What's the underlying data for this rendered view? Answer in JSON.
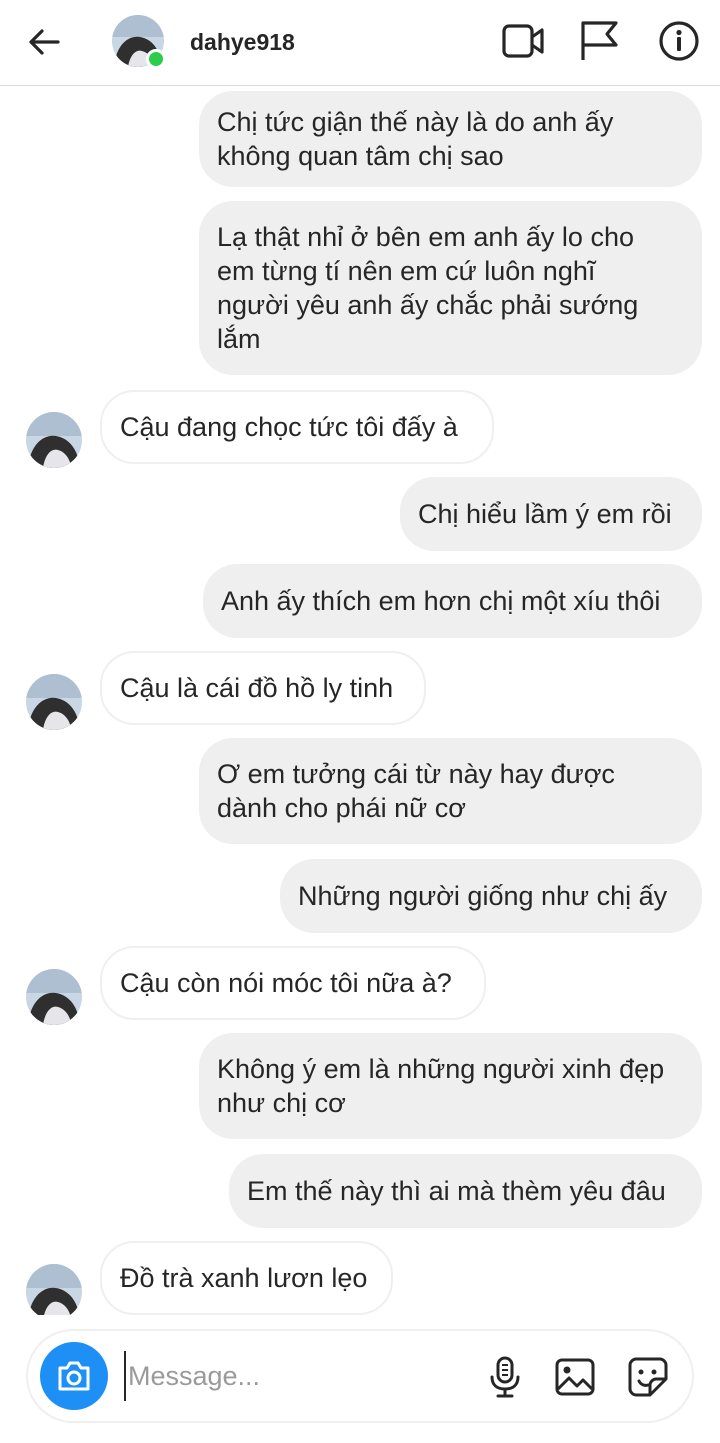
{
  "header": {
    "username": "dahye918",
    "online": true
  },
  "icons": {
    "back": "arrow-left-icon",
    "video": "video-call-icon",
    "flag": "flag-icon",
    "info": "info-icon",
    "camera": "camera-icon",
    "mic": "microphone-icon",
    "gallery": "gallery-icon",
    "sticker": "sticker-icon"
  },
  "colors": {
    "online": "#2ecc4b",
    "camera_button": "#1e90f5",
    "outgoing_bubble": "#efefef"
  },
  "messages": [
    {
      "direction": "out",
      "text": "Chị tức giận thế này là do anh ấy\nkhông quan tâm chị sao"
    },
    {
      "direction": "out",
      "text": "Lạ thật nhỉ ở bên em anh ấy lo cho\nem từng tí nên em cứ luôn nghĩ\nngười yêu anh ấy chắc phải sướng\nlắm"
    },
    {
      "direction": "in",
      "text": "Cậu đang chọc tức tôi đấy à"
    },
    {
      "direction": "out",
      "text": "Chị hiểu lầm ý em rồi"
    },
    {
      "direction": "out",
      "text": "Anh ấy thích em hơn chị một xíu thôi"
    },
    {
      "direction": "in",
      "text": "Cậu là cái đồ hồ ly tinh"
    },
    {
      "direction": "out",
      "text": "Ơ em tưởng cái từ này hay được\ndành cho phái nữ cơ"
    },
    {
      "direction": "out",
      "text": "Những người giống như chị ấy"
    },
    {
      "direction": "in",
      "text": "Cậu còn nói móc tôi nữa à?"
    },
    {
      "direction": "out",
      "text": "Không ý em là những người xinh đẹp\nnhư chị cơ"
    },
    {
      "direction": "out",
      "text": "Em thế này thì ai mà thèm yêu đâu"
    },
    {
      "direction": "in",
      "text": "Đồ trà xanh lươn lẹo"
    }
  ],
  "composer": {
    "placeholder": "Message...",
    "value": ""
  }
}
